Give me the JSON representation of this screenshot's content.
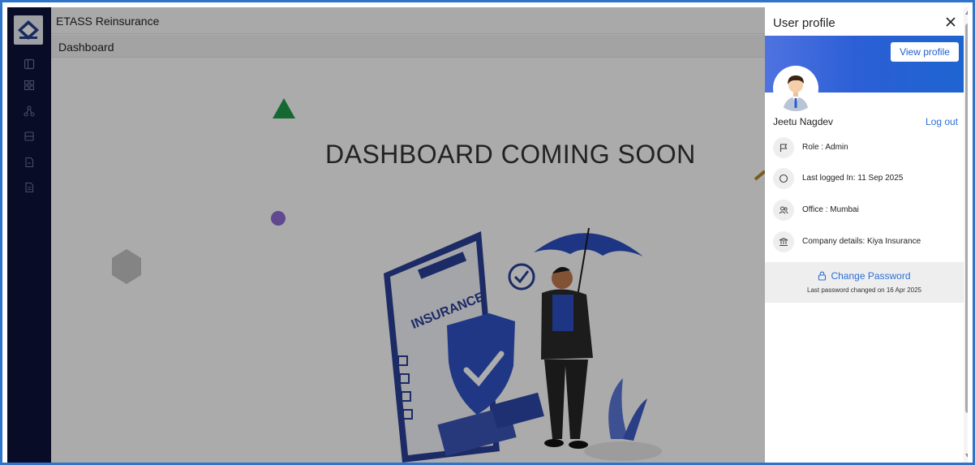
{
  "app": {
    "title": "ETASS Reinsurance"
  },
  "page": {
    "title": "Dashboard",
    "message": "DASHBOARD COMING SOON"
  },
  "sidebar": {
    "icons": [
      "panel-icon",
      "grid-icon",
      "hierarchy-icon",
      "database-icon",
      "document-icon",
      "file-icon"
    ]
  },
  "profile_panel": {
    "title": "User profile",
    "view_profile_label": "View profile",
    "user_name": "Jeetu Nagdev",
    "logout_label": "Log out",
    "role": "Role : Admin",
    "last_logged_in": "Last logged In: 11 Sep 2025",
    "office": "Office : Mumbai",
    "company": "Company details: Kiya Insurance",
    "change_password_label": "Change Password",
    "password_note": "Last password changed on 16 Apr 2025"
  },
  "colors": {
    "sidebar": "#0c1238",
    "banner": "#2c5fd6",
    "link": "#2a6fd6",
    "frame": "#2f74c8"
  }
}
